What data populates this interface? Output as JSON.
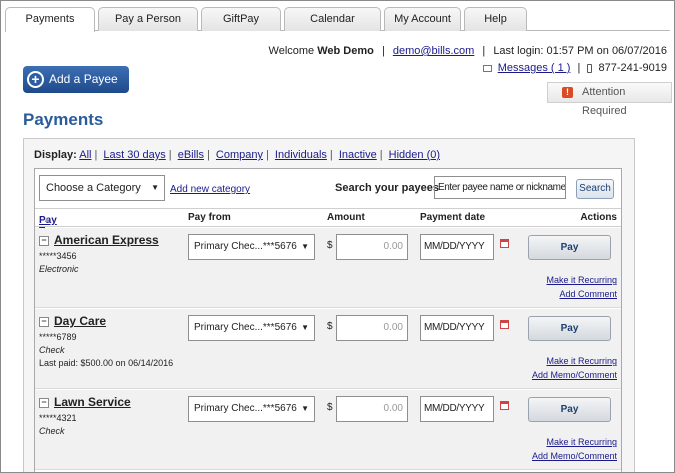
{
  "tabs": [
    {
      "label": "Payments",
      "active": true
    },
    {
      "label": "Pay a Person",
      "active": false
    },
    {
      "label": "GiftPay",
      "active": false
    },
    {
      "label": "Calendar",
      "active": false
    },
    {
      "label": "My Account",
      "active": false
    },
    {
      "label": "Help",
      "active": false
    }
  ],
  "header": {
    "welcome_prefix": "Welcome",
    "user_name": "Web Demo",
    "email": "demo@bills.com",
    "last_login": "Last login: 01:57 PM on 06/07/2016",
    "messages": "Messages ( 1 )",
    "phone": "877-241-9019",
    "attention": "Attention Required"
  },
  "add_payee_label": "Add a Payee",
  "page_title": "Payments",
  "display": {
    "label": "Display:",
    "filters": [
      "All",
      "Last 30 days",
      "eBills",
      "Company",
      "Individuals",
      "Inactive",
      "Hidden (0)"
    ]
  },
  "filterbar": {
    "category_select": "Choose a Category",
    "add_category": "Add new category",
    "search_label": "Search your payees",
    "search_placeholder": "Enter payee name or nickname",
    "search_button": "Search"
  },
  "columns": {
    "pay_to": "Pay To",
    "pay_from": "Pay from",
    "amount": "Amount",
    "payment_date": "Payment date",
    "actions": "Actions"
  },
  "payees": [
    {
      "name": "American Express",
      "account": "*****3456",
      "type": "Electronic",
      "last_paid": "",
      "pay_from": "Primary Chec...***5676",
      "currency": "$",
      "amount": "0.00",
      "date": "MM/DD/YYYY",
      "pay_label": "Pay",
      "link1": "Make it Recurring",
      "link2": "Add Comment"
    },
    {
      "name": "Day Care",
      "account": "*****6789",
      "type": "Check",
      "last_paid": "Last paid: $500.00 on 06/14/2016",
      "pay_from": "Primary Chec...***5676",
      "currency": "$",
      "amount": "0.00",
      "date": "MM/DD/YYYY",
      "pay_label": "Pay",
      "link1": "Make it Recurring",
      "link2": "Add Memo/Comment"
    },
    {
      "name": "Lawn Service",
      "account": "*****4321",
      "type": "Check",
      "last_paid": "",
      "pay_from": "Primary Chec...***5676",
      "currency": "$",
      "amount": "0.00",
      "date": "MM/DD/YYYY",
      "pay_label": "Pay",
      "link1": "Make it Recurring",
      "link2": "Add Memo/Comment"
    }
  ]
}
